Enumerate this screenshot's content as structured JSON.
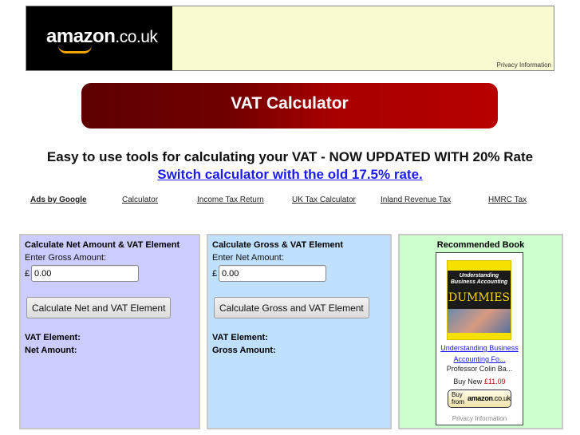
{
  "banner": {
    "logo_main": "amazon",
    "logo_suffix": ".co.uk",
    "privacy_link": "Privacy Information"
  },
  "header": {
    "title": "VAT Calculator"
  },
  "intro": {
    "tagline": "Easy to use tools for calculating your VAT - NOW UPDATED WITH 20% Rate",
    "switch_link": "Switch calculator with the old 17.5% rate."
  },
  "ad_links": {
    "ads_by_google": "Ads by Google",
    "items": [
      {
        "label": "Calculator"
      },
      {
        "label": "Income Tax Return"
      },
      {
        "label": "UK Tax Calculator"
      },
      {
        "label": "Inland Revenue Tax"
      },
      {
        "label": "HMRC Tax"
      }
    ]
  },
  "net_calculator": {
    "title": "Calculate Net Amount & VAT Element",
    "input_label": "Enter Gross Amount:",
    "currency_symbol": "£",
    "input_value": "0.00",
    "button_label": "Calculate Net and VAT Element",
    "result_vat_label": "VAT Element:",
    "result_amount_label": "Net Amount:",
    "background_color": "#ccccff"
  },
  "gross_calculator": {
    "title": "Calculate Gross & VAT Element",
    "input_label": "Enter Net Amount:",
    "currency_symbol": "£",
    "input_value": "0.00",
    "button_label": "Calculate Gross and VAT Element",
    "result_vat_label": "VAT Element:",
    "result_amount_label": "Gross Amount:",
    "background_color": "#bfe0ff"
  },
  "book": {
    "heading": "Recommended Book",
    "cover_title": "Understanding Business Accounting",
    "cover_series": "DUMMIES",
    "title_line1": "Understanding Business",
    "title_line2": "Accounting Fo...",
    "author": "Professor Colin Ba...",
    "price_label": "Buy New",
    "price": "£11.09",
    "buy_text_1": "Buy",
    "buy_text_2": "from",
    "buy_logo_main": "amazon",
    "buy_logo_suffix": ".co.uk",
    "privacy": "Privacy Information",
    "background_color": "#ccffcc"
  }
}
